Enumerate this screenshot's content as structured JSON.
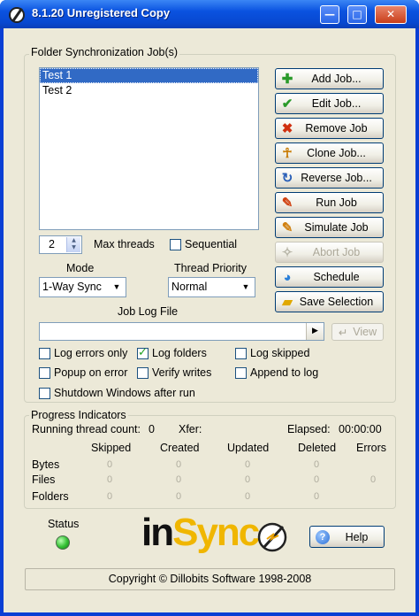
{
  "window": {
    "title": "8.1.20 Unregistered Copy",
    "controls": {
      "minimize": "—",
      "maximize": "□",
      "close": "✕"
    }
  },
  "jobs_group": {
    "label": "Folder Synchronization Job(s)",
    "jobs": [
      "Test 1",
      "Test 2"
    ],
    "selected_job": "Test 1"
  },
  "buttons": {
    "add_job": "Add Job...",
    "edit_job": "Edit Job...",
    "remove_job": "Remove Job",
    "clone_job": "Clone Job...",
    "reverse_job": "Reverse Job...",
    "run_job": "Run Job",
    "simulate_job": "Simulate Job",
    "abort_job": "Abort Job",
    "schedule": "Schedule",
    "save_selection": "Save Selection",
    "view": "View",
    "help": "Help"
  },
  "options": {
    "max_threads_value": "2",
    "max_threads_label": "Max threads",
    "sequential_label": "Sequential",
    "sequential_checked": false,
    "mode_label": "Mode",
    "mode_value": "1-Way Sync",
    "thread_priority_label": "Thread Priority",
    "thread_priority_value": "Normal",
    "job_log_file_label": "Job Log File",
    "job_log_file_value": ""
  },
  "checkboxes": {
    "log_errors_only": {
      "label": "Log errors only",
      "checked": false
    },
    "log_folders": {
      "label": "Log folders",
      "checked": true
    },
    "log_skipped": {
      "label": "Log skipped",
      "checked": false
    },
    "popup_on_error": {
      "label": "Popup on error",
      "checked": false
    },
    "verify_writes": {
      "label": "Verify writes",
      "checked": false
    },
    "append_to_log": {
      "label": "Append to log",
      "checked": false
    },
    "shutdown_windows": {
      "label": "Shutdown Windows after run",
      "checked": false
    }
  },
  "progress": {
    "label": "Progress Indicators",
    "running_thread_count_label": "Running thread count:",
    "running_thread_count": "0",
    "xfer_label": "Xfer:",
    "xfer_value": "",
    "elapsed_label": "Elapsed:",
    "elapsed_value": "00:00:00",
    "columns": [
      "Skipped",
      "Created",
      "Updated",
      "Deleted",
      "Errors"
    ],
    "rows": [
      {
        "label": "Bytes",
        "values": [
          "0",
          "0",
          "0",
          "0",
          ""
        ]
      },
      {
        "label": "Files",
        "values": [
          "0",
          "0",
          "0",
          "0",
          "0"
        ]
      },
      {
        "label": "Folders",
        "values": [
          "0",
          "0",
          "0",
          "0",
          ""
        ]
      }
    ]
  },
  "status": {
    "label": "Status",
    "led_color": "#33c033"
  },
  "logo": {
    "part1": "in",
    "part2": "Sync"
  },
  "footer": {
    "copyright": "Copyright © Dillobits Software 1998-2008"
  },
  "icons": {
    "add": "plus-icon",
    "edit": "checkmark-icon",
    "remove": "x-icon",
    "clone": "person-icon",
    "reverse": "reverse-arrow-icon",
    "run": "pen-icon",
    "simulate": "pen-icon",
    "abort": "abort-icon",
    "schedule": "globe-icon",
    "save": "folder-icon",
    "help": "help-icon"
  }
}
